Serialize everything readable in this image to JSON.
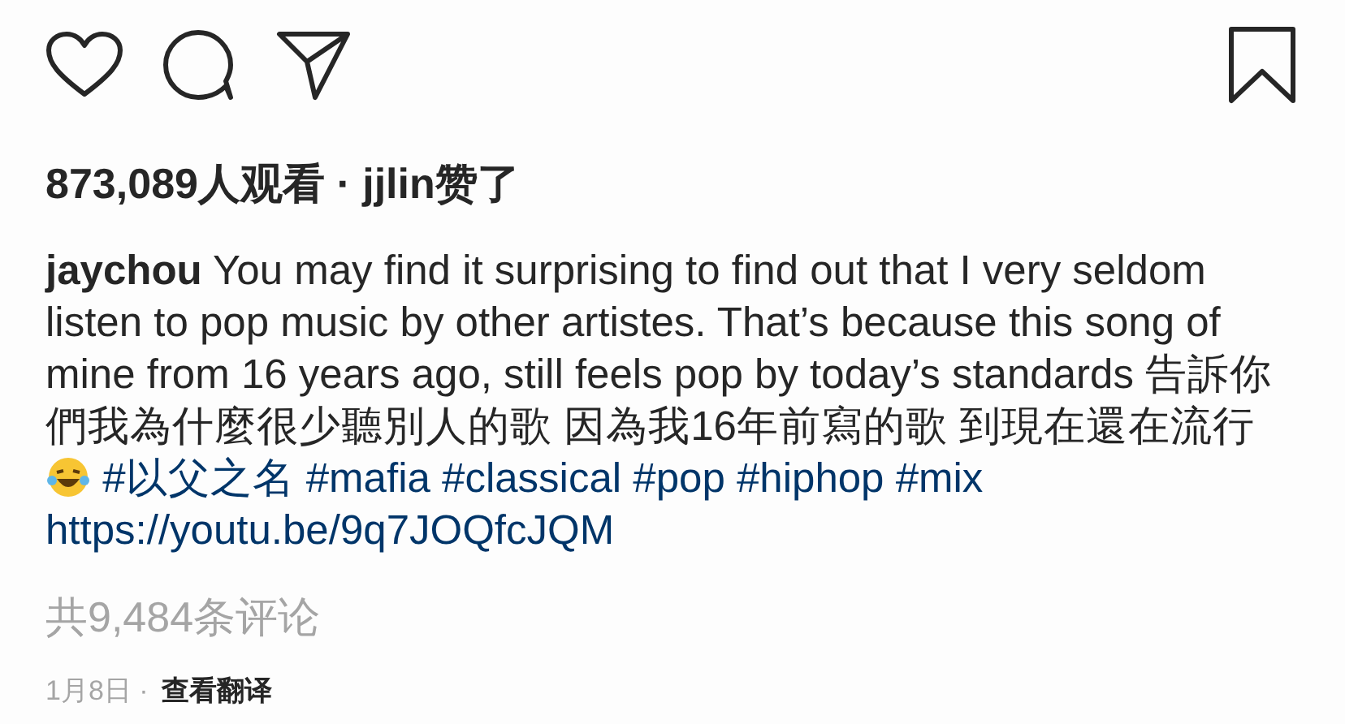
{
  "actions": [
    {
      "kind": "like"
    },
    {
      "kind": "comment"
    },
    {
      "kind": "share"
    },
    {
      "kind": "save"
    }
  ],
  "likes_line": "873,089人观看 · jjlin赞了",
  "caption": {
    "username": "jaychou",
    "segments": [
      {
        "kind": "text",
        "text": "You may find it surprising to find out that I very seldom listen to pop music by other artistes. That’s because this song of mine from 16 years ago, still feels pop by today’s standards 告訴你們我為什麼很少聽別人的歌 因為我16年前寫的歌 到現在還在流行"
      },
      {
        "kind": "emoji"
      },
      {
        "kind": "hashtag",
        "text": "#以父之名"
      },
      {
        "kind": "hashtag",
        "text": "#mafia"
      },
      {
        "kind": "hashtag",
        "text": "#classical"
      },
      {
        "kind": "hashtag",
        "text": "#pop"
      },
      {
        "kind": "hashtag",
        "text": "#hiphop"
      },
      {
        "kind": "hashtag",
        "text": "#mix"
      },
      {
        "kind": "link",
        "text": "https://youtu.be/9q7JOQfcJQM"
      }
    ]
  },
  "comments_link": "共9,484条评论",
  "date": "1月8日 ·",
  "translate": "查看翻译"
}
